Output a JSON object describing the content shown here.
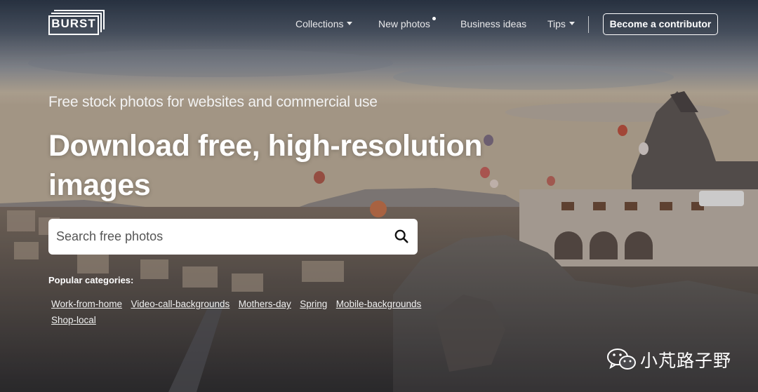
{
  "brand": {
    "logo_text": "BURST"
  },
  "nav": {
    "collections": "Collections",
    "new_photos": "New photos",
    "business_ideas": "Business ideas",
    "tips": "Tips",
    "contributor_button": "Become a contributor"
  },
  "hero": {
    "subtitle": "Free stock photos for websites and commercial use",
    "headline": "Download free, high-resolution images"
  },
  "search": {
    "placeholder": "Search free photos",
    "value": ""
  },
  "popular": {
    "label": "Popular categories:",
    "categories": [
      "Work-from-home",
      "Video-call-backgrounds",
      "Mothers-day",
      "Spring",
      "Mobile-backgrounds",
      "Shop-local"
    ]
  },
  "watermark": {
    "text": "小芃路子野"
  },
  "colors": {
    "button_border": "#ffffff",
    "search_bg": "#ffffff",
    "text": "#ffffff"
  }
}
